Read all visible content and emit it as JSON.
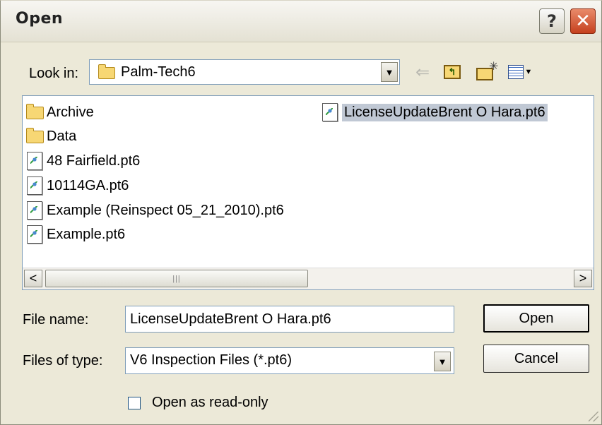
{
  "window": {
    "title": "Open",
    "help_label": "?",
    "close_label": "✕"
  },
  "toolbar": {
    "look_in_label": "Look in:",
    "look_in_value": "Palm-Tech6",
    "back_icon": "back-arrow-icon",
    "up_icon": "up-one-level-icon",
    "new_folder_icon": "new-folder-icon",
    "views_icon": "views-menu-icon"
  },
  "files": {
    "items": [
      {
        "name": "Archive",
        "type": "folder"
      },
      {
        "name": "Data",
        "type": "folder"
      },
      {
        "name": "48 Fairfield.pt6",
        "type": "file"
      },
      {
        "name": "10114GA.pt6",
        "type": "file"
      },
      {
        "name": "Example (Reinspect 05_21_2010).pt6",
        "type": "file"
      },
      {
        "name": "Example.pt6",
        "type": "file"
      },
      {
        "name": "LicenseUpdateBrent O Hara.pt6",
        "type": "file",
        "selected": true
      }
    ]
  },
  "form": {
    "file_name_label": "File name:",
    "file_name_value": "LicenseUpdateBrent O Hara.pt6",
    "file_type_label": "Files of type:",
    "file_type_value": "V6 Inspection Files (*.pt6)",
    "read_only_label": "Open as read-only",
    "read_only_checked": false
  },
  "buttons": {
    "open_label": "Open",
    "cancel_label": "Cancel"
  },
  "colors": {
    "dialog_bg": "#ece9d8",
    "selection_bg": "#c0c8d4",
    "field_border": "#7f9db9",
    "close_button": "#c5401e"
  }
}
